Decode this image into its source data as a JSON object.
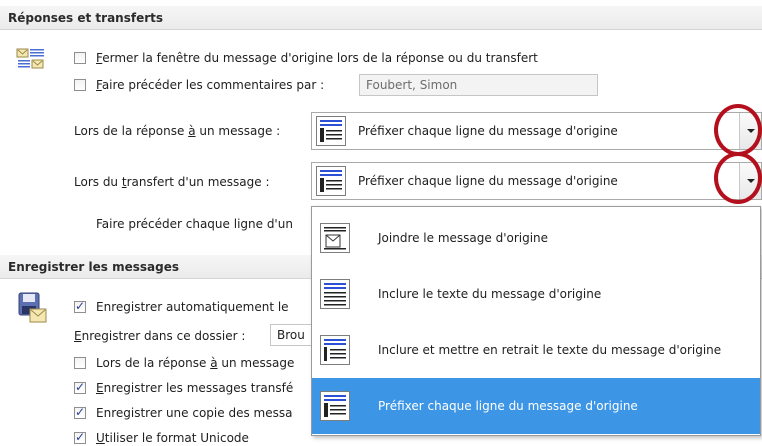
{
  "sections": {
    "replies_header": "Réponses et transferts",
    "save_header": "Enregistrer les messages"
  },
  "replies": {
    "close_original": {
      "label_u": "F",
      "label_rest": "ermer la fenêtre du message d'origine lors de la réponse ou du transfert",
      "checked": false
    },
    "preface_comments": {
      "label_u": "F",
      "label_rest": "aire précéder les commentaires par :",
      "checked": false,
      "value": "Foubert, Simon"
    },
    "reply_label_pre": "Lors de la réponse ",
    "reply_label_u": "à",
    "reply_label_post": " un message :",
    "reply_value": "Préfixer chaque ligne du message d'origine",
    "forward_label_pre": "Lors du ",
    "forward_label_u": "t",
    "forward_label_post": "ransfert d'un message :",
    "forward_value": "Préfixer chaque ligne du message d'origine",
    "prefix_each_line_label": "Faire précéder chaque ligne d'un"
  },
  "dropdown": {
    "options": [
      {
        "label": "Joindre le message d'origine",
        "icon": "attach-original-icon",
        "selected": false
      },
      {
        "label": "Inclure le texte du message d'origine",
        "icon": "include-text-icon",
        "selected": false
      },
      {
        "label": "Inclure et mettre en retrait le texte du message d'origine",
        "icon": "include-indent-icon",
        "selected": false
      },
      {
        "label": "Préfixer chaque ligne du message d'origine",
        "icon": "prefix-lines-icon",
        "selected": true
      }
    ]
  },
  "save": {
    "autosave": {
      "label": "Enregistrer automatiquement le",
      "checked": true
    },
    "folder_label_u": "E",
    "folder_label_rest": "nregistrer dans ce dossier :",
    "folder_value": "Brou",
    "on_reply": {
      "label_pre": "Lors de la réponse ",
      "label_u": "à",
      "label_post": " un message",
      "checked": false
    },
    "save_forwarded": {
      "label_u": "E",
      "label_rest": "nregistrer les messages transfé",
      "checked": true
    },
    "save_copy": {
      "label": "Enregistrer une copie des messa",
      "checked": true
    },
    "unicode": {
      "label_u": "U",
      "label_rest": "tiliser le format Unicode",
      "checked": true
    }
  },
  "colors": {
    "highlight": "#3d95e6",
    "ring": "#b40f1c",
    "accent_blue": "#2a3e8c"
  }
}
